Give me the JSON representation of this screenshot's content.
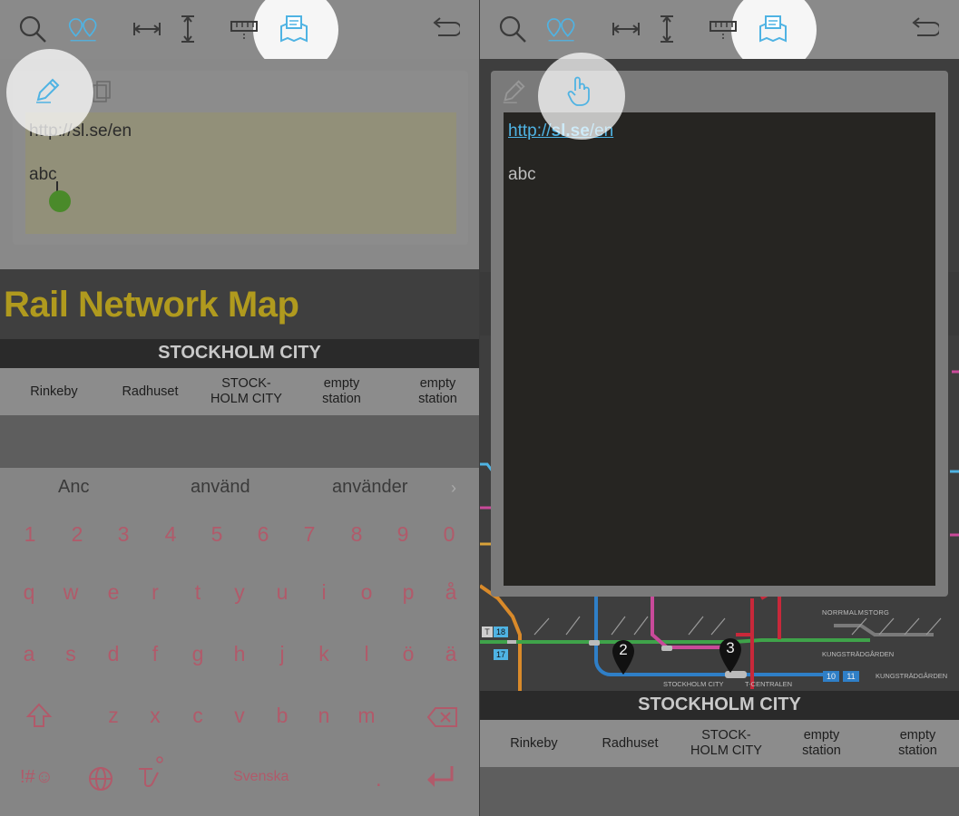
{
  "left": {
    "toolbar": {
      "icons": [
        "search-icon",
        "pins-icon",
        "horizontal-measure-icon",
        "vertical-measure-icon",
        "ruler-icon",
        "map-note-icon",
        "undo-icon"
      ]
    },
    "note": {
      "url": "http://sl.se/en",
      "text": "abc"
    },
    "map": {
      "title": "Rail Network Map",
      "current_station": "STOCKHOLM CITY",
      "stations": [
        {
          "line1": "Rinkeby",
          "line2": ""
        },
        {
          "line1": "Radhuset",
          "line2": ""
        },
        {
          "line1": "STOCK-",
          "line2": "HOLM CITY"
        },
        {
          "line1": "empty",
          "line2": "station"
        },
        {
          "line1": "empty",
          "line2": "station"
        }
      ]
    },
    "keyboard": {
      "suggestions": [
        "Anc",
        "använd",
        "använder"
      ],
      "row_numbers": [
        "1",
        "2",
        "3",
        "4",
        "5",
        "6",
        "7",
        "8",
        "9",
        "0"
      ],
      "row1": [
        "q",
        "w",
        "e",
        "r",
        "t",
        "y",
        "u",
        "i",
        "o",
        "p",
        "å"
      ],
      "row2": [
        "a",
        "s",
        "d",
        "f",
        "g",
        "h",
        "j",
        "k",
        "l",
        "ö",
        "ä"
      ],
      "row3": [
        "z",
        "x",
        "c",
        "v",
        "b",
        "n",
        "m"
      ],
      "symbols_label": "!#☺",
      "space_label": "Svenska",
      "period": "."
    }
  },
  "right": {
    "note": {
      "url_prefix": "http://",
      "url_domain": "sl.se",
      "url_suffix": "/en",
      "text": "abc"
    },
    "map": {
      "current_station": "STOCKHOLM CITY",
      "stations": [
        {
          "line1": "Rinkeby",
          "line2": ""
        },
        {
          "line1": "Radhuset",
          "line2": ""
        },
        {
          "line1": "STOCK-",
          "line2": "HOLM CITY"
        },
        {
          "line1": "empty",
          "line2": "station"
        },
        {
          "line1": "empty",
          "line2": "station"
        }
      ],
      "markers": [
        "2",
        "3"
      ],
      "labels": {
        "norrmalmstorg": "NORRMALMSTORG",
        "kungstradgarden_top": "KUNGSTRÄDGÅRDEN",
        "kungstradgarden_bottom": "KUNGSTRÄDGÅRDEN",
        "stockholm_city_small": "STOCKHOLM CITY",
        "t_centralen": "T-CENTRALEN",
        "line_10": "10",
        "line_11": "11",
        "line_17": "17",
        "line_18": "18"
      }
    }
  },
  "colors": {
    "accent_blue": "#4fb3e3",
    "map_title": "#b09a1e",
    "keyboard_key": "#b15a6a",
    "green_marker": "#4a8a2a"
  }
}
